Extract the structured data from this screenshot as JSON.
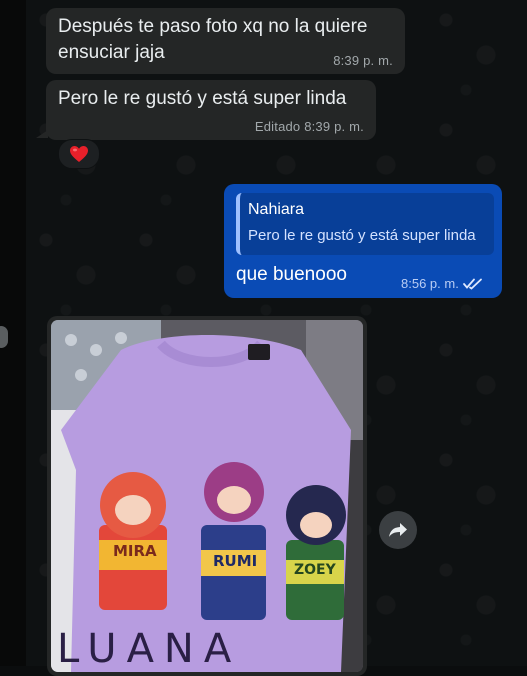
{
  "messages": {
    "m1": {
      "text_line1": "Después te paso foto xq no la quiere",
      "text_line2": "ensuciar jaja",
      "time": "8:39 p. m."
    },
    "m2": {
      "text": "Pero le re gustó y está super linda",
      "edited_label": "Editado",
      "time": "8:39 p. m."
    },
    "reaction": {
      "emoji": "❤️"
    },
    "m3": {
      "quote_author": "Nahiara",
      "quote_text": "Pero le re gustó y está super linda",
      "text": "que buenooo",
      "time": "8:56 p. m.",
      "status": "✓✓"
    },
    "m4": {
      "shirt_label": "LUANA",
      "cup_labels": [
        "MIRA",
        "RUMI",
        "ZOEY"
      ]
    }
  },
  "colors": {
    "incoming_bubble": "#242626",
    "outgoing_bubble": "#0a4bb5",
    "shirt": "#b79ce0"
  },
  "icons": {
    "forward": "forward-arrow-icon",
    "read": "double-check-icon"
  }
}
